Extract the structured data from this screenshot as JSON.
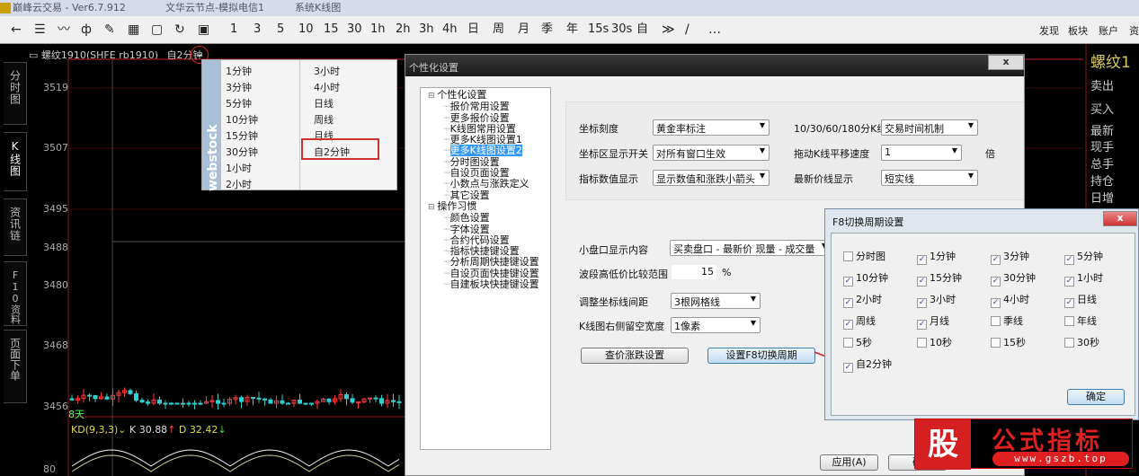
{
  "titlebar": {
    "app": "巅峰云交易 - Ver6.7.912",
    "node": "文华云节点-模拟电信1",
    "view": "系统K线图"
  },
  "toolbar": {
    "icons": [
      "back-arrow-icon",
      "list-icon",
      "line-chart-icon",
      "candle-icon",
      "draw-icon",
      "grid-icon",
      "save-icon",
      "refresh-icon",
      "chart-window-icon"
    ],
    "periods": [
      "1",
      "3",
      "5",
      "10",
      "15",
      "30",
      "1h",
      "2h",
      "3h",
      "4h",
      "日",
      "周",
      "月",
      "季",
      "年",
      "15s",
      "30s",
      "自"
    ],
    "extra": [
      "≫",
      "/",
      "…"
    ],
    "right": [
      "发现",
      "板块",
      "账户",
      "资"
    ]
  },
  "chart": {
    "symbol": "螺纹1910(SHFE rb1910)",
    "period": "自2分钟",
    "yticks": [
      "3519",
      "3507",
      "3495",
      "3488",
      "3480",
      "3468",
      "3456",
      "80"
    ],
    "marker": "8天",
    "indicator": "KD(9,3,3)",
    "k_label": "K 30.88",
    "d_label": "D 32.42",
    "side_tabs": [
      "分时图",
      "K线图",
      "资讯链",
      "F10资料",
      "页面下单"
    ],
    "colors": {
      "up": "#ff3b3b",
      "down": "#30d0d0",
      "grid": "#8a1a1a"
    }
  },
  "period_menu": {
    "brand": "webstock",
    "col1": [
      "1分钟",
      "3分钟",
      "5分钟",
      "10分钟",
      "15分钟",
      "30分钟",
      "1小时",
      "2小时"
    ],
    "col2": [
      "3小时",
      "4小时",
      "日线",
      "周线",
      "月线",
      "自2分钟"
    ],
    "selected": "自2分钟"
  },
  "settings": {
    "title": "个性化设置",
    "close": "x",
    "tree": [
      {
        "label": "个性化设置",
        "group": true
      },
      {
        "label": "报价常用设置"
      },
      {
        "label": "更多报价设置"
      },
      {
        "label": "K线图常用设置"
      },
      {
        "label": "更多K线图设置1"
      },
      {
        "label": "更多K线图设置2",
        "selected": true
      },
      {
        "label": "分时图设置"
      },
      {
        "label": "自设页面设置"
      },
      {
        "label": "小数点与涨跌定义"
      },
      {
        "label": "其它设置"
      },
      {
        "label": "操作习惯",
        "group": true
      },
      {
        "label": "颜色设置"
      },
      {
        "label": "字体设置"
      },
      {
        "label": "合约代码设置"
      },
      {
        "label": "指标快捷键设置"
      },
      {
        "label": "分析周期快捷键设置"
      },
      {
        "label": "自设页面快捷键设置"
      },
      {
        "label": "自建板块快捷键设置"
      }
    ],
    "coord_scale": {
      "label": "坐标刻度",
      "value": "黄金率标注"
    },
    "coord_switch": {
      "label": "坐标区显示开关",
      "value": "对所有窗口生效"
    },
    "indicator_display": {
      "label": "指标数值显示",
      "value": "显示数值和涨跌小箭头"
    },
    "kline_mech": {
      "label": "10/30/60/180分K线",
      "value": "交易时间机制"
    },
    "drag_speed": {
      "label": "拖动K线平移速度",
      "value": "1",
      "unit": "倍"
    },
    "last_price_line": {
      "label": "最新价线显示",
      "value": "短实线"
    },
    "mini_panel": {
      "label": "小盘口显示内容",
      "value": "买卖盘口 - 最新价 现量 - 成交量"
    },
    "wave_range": {
      "label": "波段高低价比较范围",
      "value": "15",
      "unit": "%"
    },
    "grid_spacing": {
      "label": "调整坐标线间距",
      "value": "3根网格线"
    },
    "right_margin": {
      "label": "K线图右侧留空宽度",
      "value": "1像素"
    },
    "price_change_btn": "查价涨跌设置",
    "f8_btn": "设置F8切换周期",
    "apply_btn": "应用(A)",
    "ok_btn": "确"
  },
  "f8_dialog": {
    "title": "F8切换周期设置",
    "close": "x",
    "ok": "确定",
    "items": [
      {
        "label": "分时图",
        "checked": false
      },
      {
        "label": "1分钟",
        "checked": true
      },
      {
        "label": "3分钟",
        "checked": true
      },
      {
        "label": "5分钟",
        "checked": true
      },
      {
        "label": "10分钟",
        "checked": true
      },
      {
        "label": "15分钟",
        "checked": true
      },
      {
        "label": "30分钟",
        "checked": true
      },
      {
        "label": "1小时",
        "checked": true
      },
      {
        "label": "2小时",
        "checked": true
      },
      {
        "label": "3小时",
        "checked": true
      },
      {
        "label": "4小时",
        "checked": true
      },
      {
        "label": "日线",
        "checked": true
      },
      {
        "label": "周线",
        "checked": true
      },
      {
        "label": "月线",
        "checked": true
      },
      {
        "label": "季线",
        "checked": false
      },
      {
        "label": "年线",
        "checked": false
      },
      {
        "label": "5秒",
        "checked": false
      },
      {
        "label": "10秒",
        "checked": false
      },
      {
        "label": "15秒",
        "checked": false
      },
      {
        "label": "30秒",
        "checked": false
      },
      {
        "label": "自2分钟",
        "checked": true
      }
    ]
  },
  "quote_panel": {
    "name": "螺纹1",
    "rows": [
      "卖出",
      "买入",
      "最新",
      "现手",
      "总手",
      "持仓",
      "日增"
    ]
  },
  "watermark": {
    "logo_char": "股",
    "title": "公式指标",
    "url": "www.gszb.top"
  }
}
